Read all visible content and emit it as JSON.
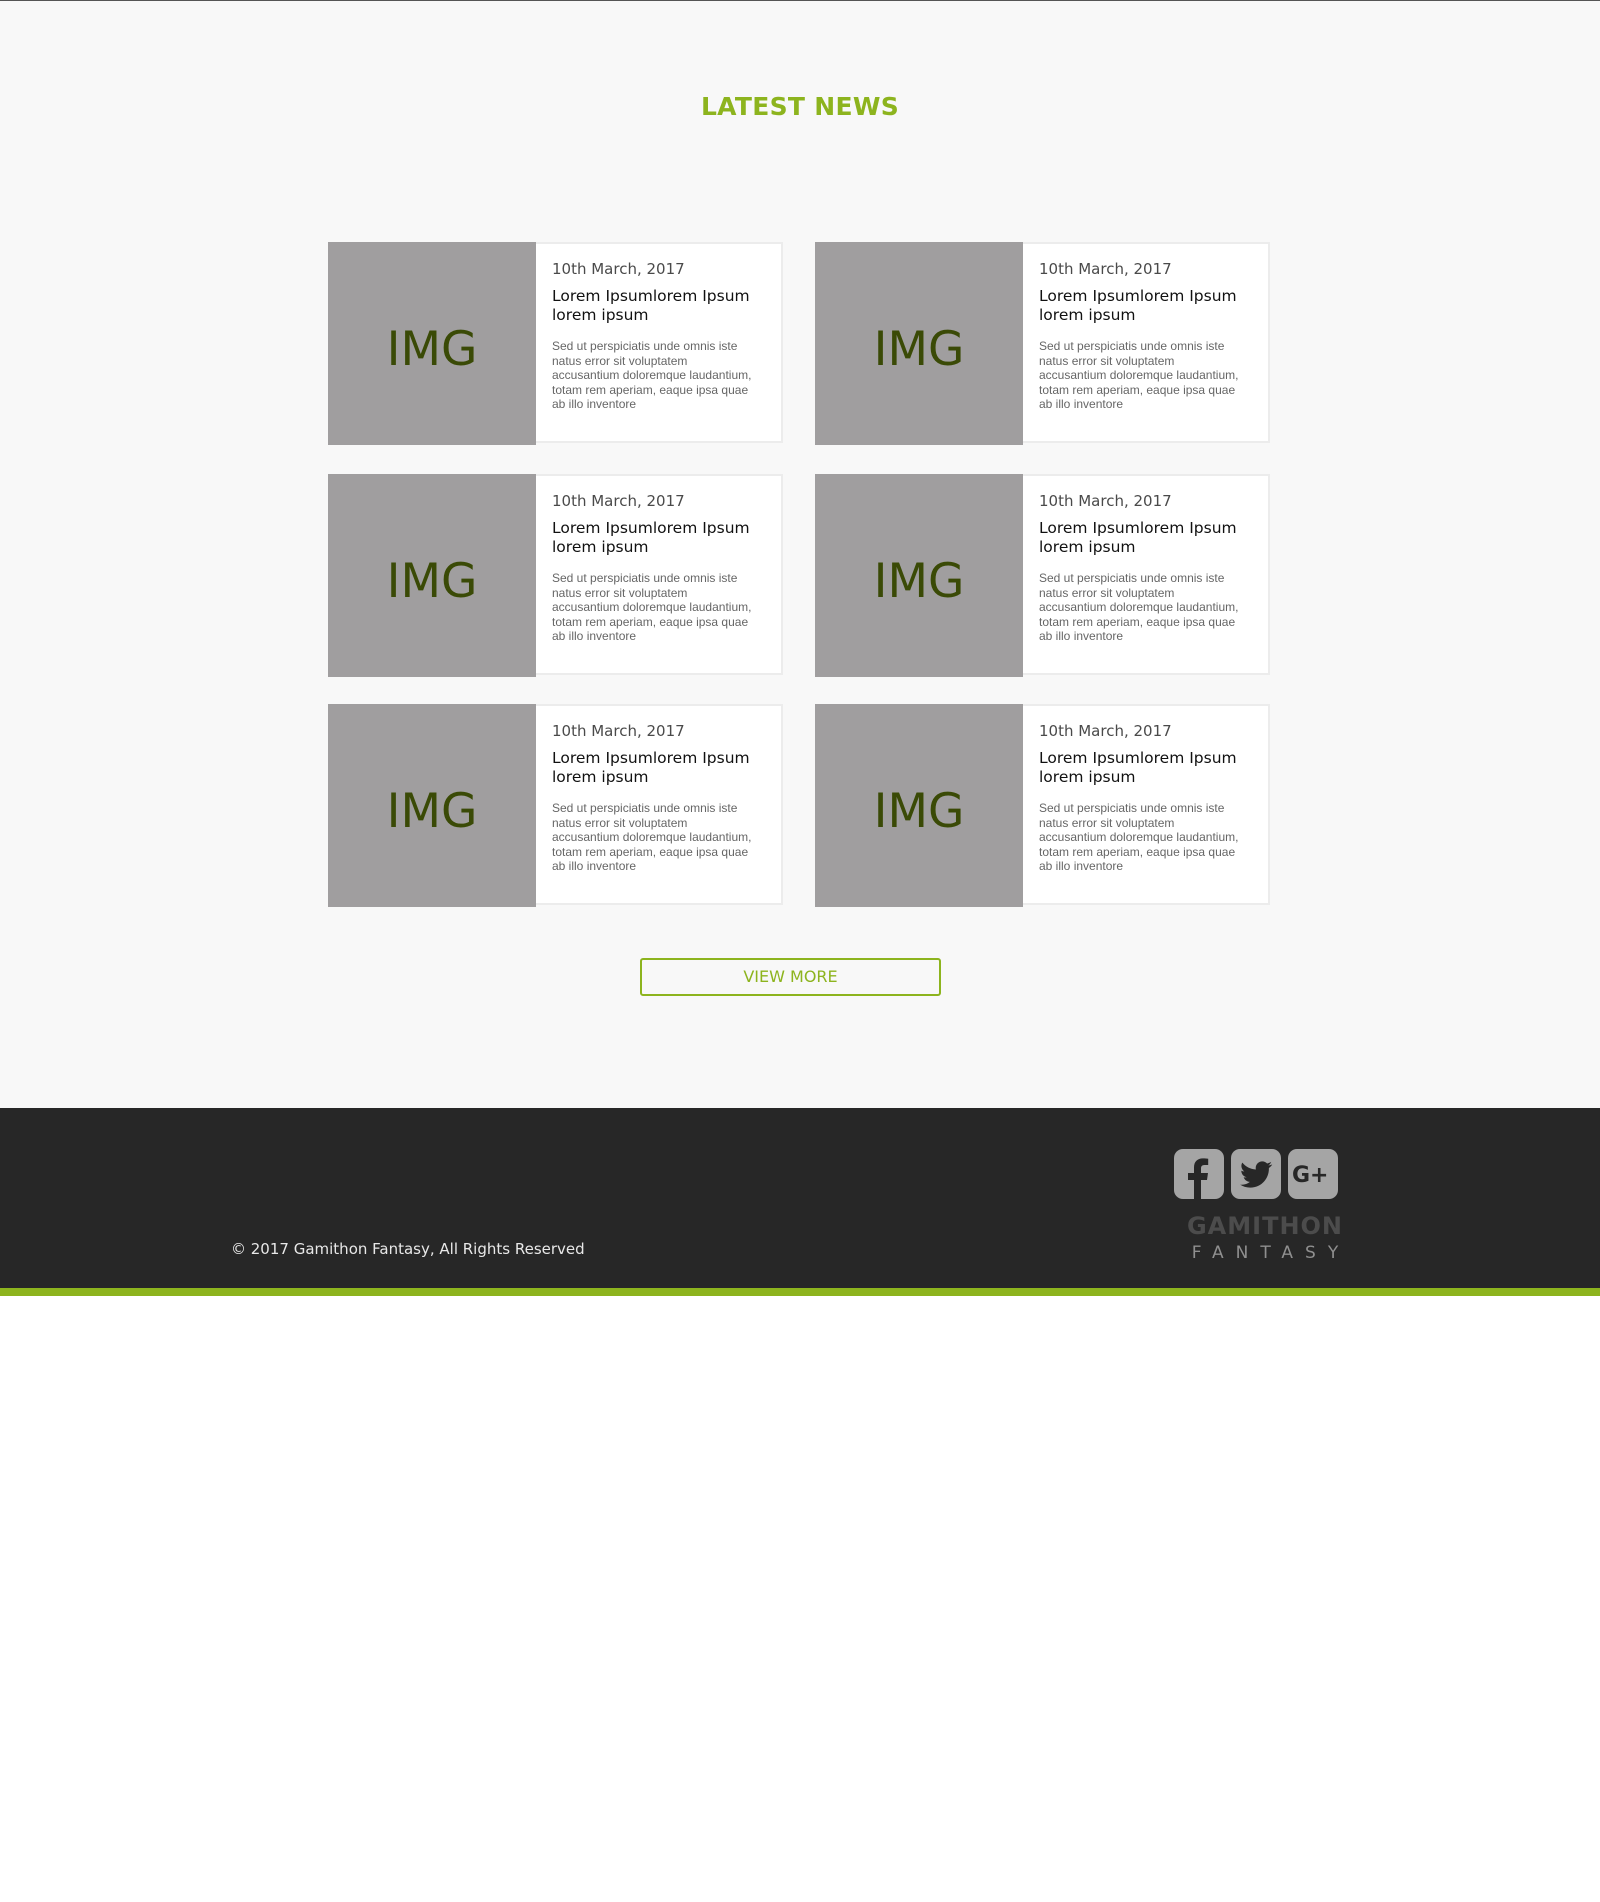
{
  "news": {
    "title": "LATEST NEWS",
    "cards": [
      {
        "img_label": "IMG",
        "date": "10th March, 2017",
        "title": "Lorem Ipsumlorem Ipsum lorem ipsum",
        "text": "Sed ut perspiciatis unde omnis iste natus error sit voluptatem accusantium doloremque laudantium, totam rem aperiam, eaque ipsa quae ab illo inventore"
      },
      {
        "img_label": "IMG",
        "date": "10th March, 2017",
        "title": "Lorem Ipsumlorem Ipsum lorem ipsum",
        "text": "Sed ut perspiciatis unde omnis iste natus error sit voluptatem accusantium doloremque laudantium, totam rem aperiam, eaque ipsa quae ab illo inventore"
      },
      {
        "img_label": "IMG",
        "date": "10th March, 2017",
        "title": "Lorem Ipsumlorem Ipsum lorem ipsum",
        "text": "Sed ut perspiciatis unde omnis iste natus error sit voluptatem accusantium doloremque laudantium, totam rem aperiam, eaque ipsa quae ab illo inventore"
      },
      {
        "img_label": "IMG",
        "date": "10th March, 2017",
        "title": "Lorem Ipsumlorem Ipsum lorem ipsum",
        "text": "Sed ut perspiciatis unde omnis iste natus error sit voluptatem accusantium doloremque laudantium, totam rem aperiam, eaque ipsa quae ab illo inventore"
      },
      {
        "img_label": "IMG",
        "date": "10th March, 2017",
        "title": "Lorem Ipsumlorem Ipsum lorem ipsum",
        "text": "Sed ut perspiciatis unde omnis iste natus error sit voluptatem accusantium doloremque laudantium, totam rem aperiam, eaque ipsa quae ab illo inventore"
      },
      {
        "img_label": "IMG",
        "date": "10th March, 2017",
        "title": "Lorem Ipsumlorem Ipsum lorem ipsum",
        "text": "Sed ut perspiciatis unde omnis iste natus error sit voluptatem accusantium doloremque laudantium, totam rem aperiam, eaque ipsa quae ab illo inventore"
      }
    ],
    "view_more_label": "VIEW MORE"
  },
  "footer": {
    "copyright": "© 2017 Gamithon Fantasy, All Rights Reserved",
    "social": [
      {
        "icon": "facebook-icon"
      },
      {
        "icon": "twitter-icon"
      },
      {
        "icon": "google-plus-icon"
      }
    ],
    "logo": {
      "word": "GAMITHON",
      "sub": "FANTASY"
    }
  },
  "colors": {
    "accent": "#8db41e",
    "footer_bg": "#272727",
    "section_bg": "#f8f8f8",
    "image_placeholder": "#a09e9f",
    "image_label": "#3a4a06",
    "icon_gray": "#a5a5a5"
  }
}
